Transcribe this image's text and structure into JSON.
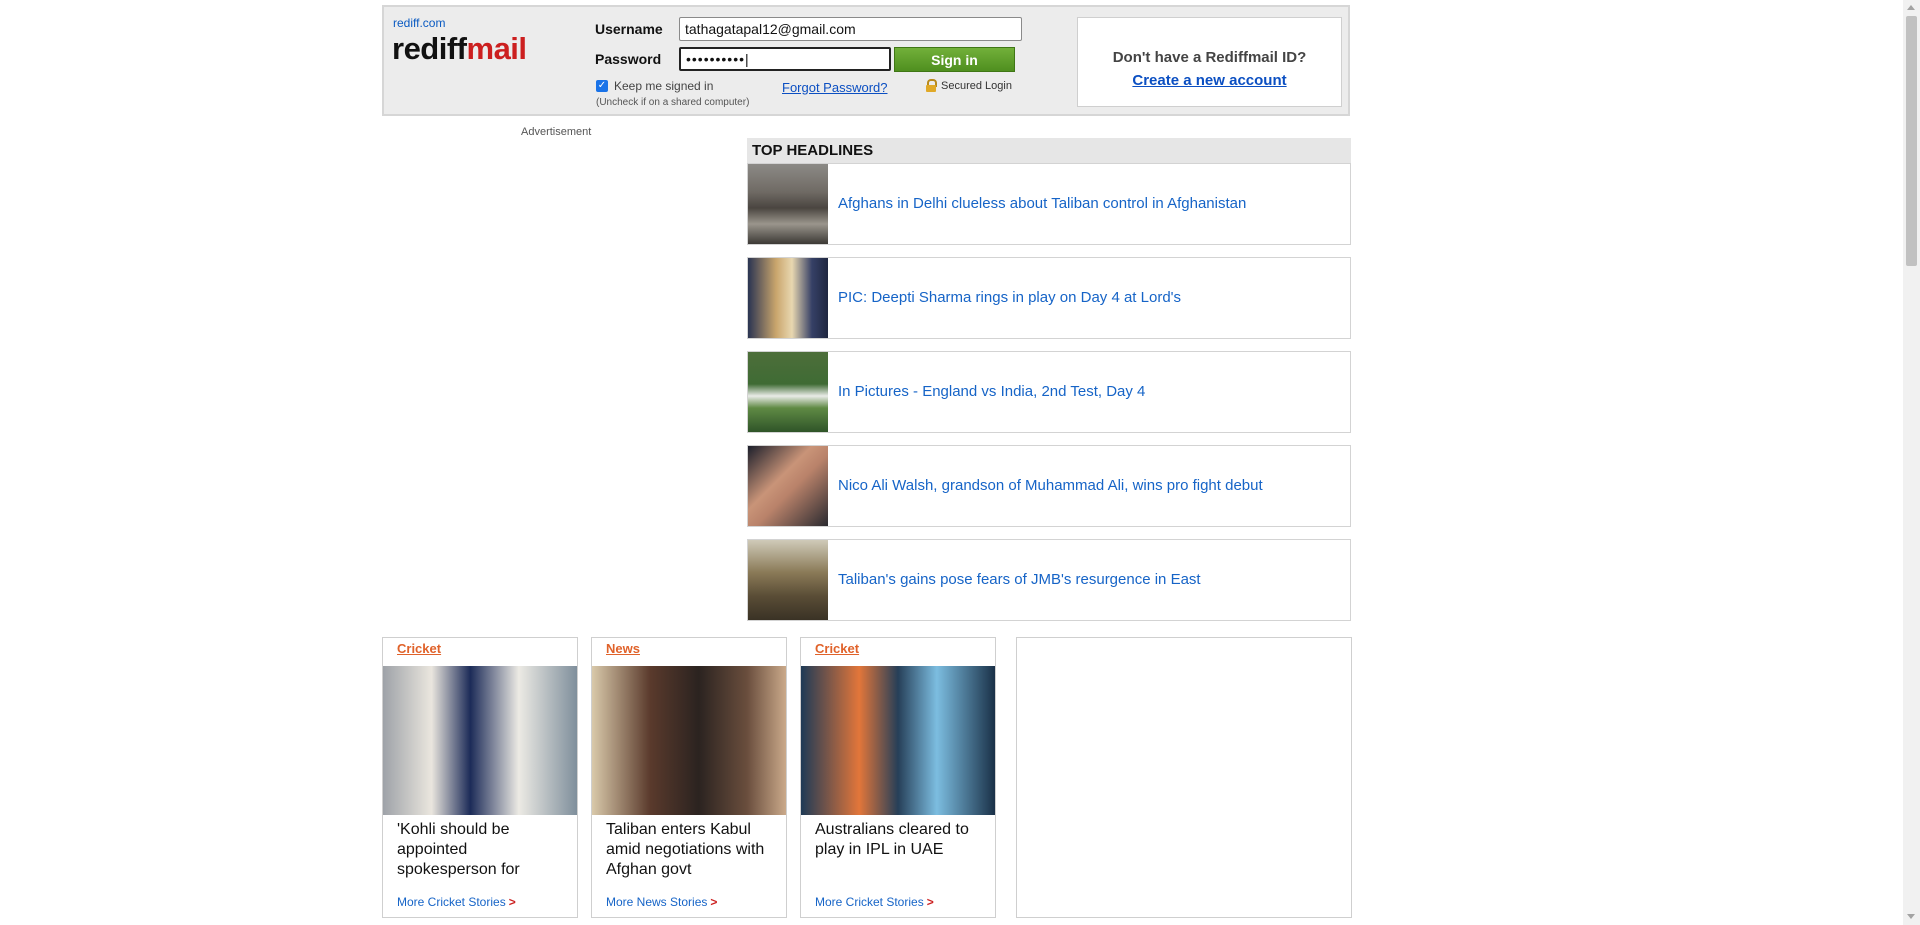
{
  "header": {
    "site_link": "rediff.com",
    "logo_part1": "rediff",
    "logo_part2": "mail",
    "username_label": "Username",
    "username_value": "tathagatapal12@gmail.com",
    "password_label": "Password",
    "password_value": "••••••••••|",
    "signin_label": "Sign in",
    "keep_signed_in": "Keep me signed in",
    "keep_signed_in_checked": true,
    "uncheck_note": "(Uncheck if on a shared computer)",
    "forgot_password": "Forgot Password?",
    "secured_login": "Secured Login",
    "signup_question": "Don't have a Rediffmail ID?",
    "signup_link": "Create a new account"
  },
  "ad_label": "Advertisement",
  "headlines": {
    "title": "TOP HEADLINES",
    "items": [
      {
        "text": "Afghans in Delhi clueless about Taliban control in Afghanistan"
      },
      {
        "text": "PIC: Deepti Sharma rings in play on Day 4 at Lord's"
      },
      {
        "text": "In Pictures - England vs India, 2nd Test, Day 4"
      },
      {
        "text": "Nico Ali Walsh, grandson of Muhammad Ali, wins pro fight debut"
      },
      {
        "text": "Taliban's gains pose fears of JMB's resurgence in East"
      }
    ]
  },
  "cards": [
    {
      "category": "Cricket",
      "story": "'Kohli should be appointed spokesperson for",
      "more": "More Cricket Stories",
      "arrow": ">"
    },
    {
      "category": "News",
      "story": "Taliban enters Kabul amid negotiations with Afghan govt",
      "more": "More News Stories",
      "arrow": ">"
    },
    {
      "category": "Cricket",
      "story": "Australians cleared to play in IPL in UAE",
      "more": "More Cricket Stories",
      "arrow": ">"
    }
  ],
  "colors": {
    "logo_mail": "#cc1f1f",
    "link_blue": "#1664c7",
    "category_orange": "#e0622a",
    "signin_green": "#5a9c28"
  }
}
